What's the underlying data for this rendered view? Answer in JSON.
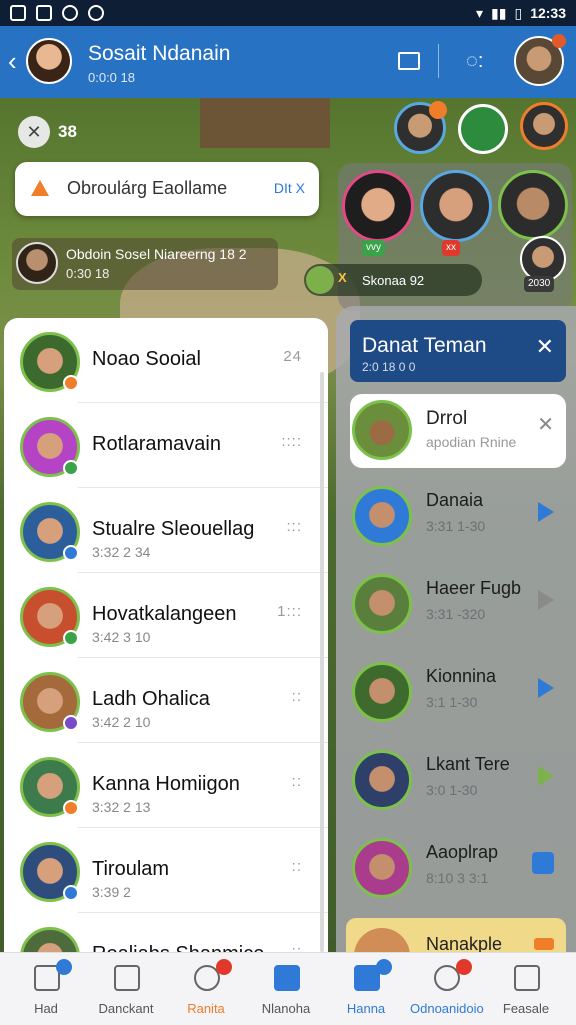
{
  "status_bar": {
    "time": "12:33"
  },
  "header": {
    "title": "Sosait Ndanain",
    "subtitle": "0:0:0 18"
  },
  "colors": {
    "header": "#2872c4",
    "accent": "#f07d2a",
    "status_online": "#7ec04c",
    "dark_blue": "#1e4a85"
  },
  "hud": {
    "counter": "38"
  },
  "notification": {
    "text": "Obroulárg Eaollame",
    "action": "DIt X"
  },
  "notice": {
    "line1": "Obdoin Sosel Niareerng 18 2",
    "line2": "0:30 18"
  },
  "status_pill": {
    "label": "Skonaa 92",
    "arrow": "X"
  },
  "cluster_chips": [
    "vvy",
    "xx"
  ],
  "cluster_time": "2030",
  "friends": [
    {
      "name": "Noao Sooial",
      "sub": "",
      "meta": "24",
      "color": "#3c6a2e"
    },
    {
      "name": "Rotlaramavain",
      "sub": "",
      "meta": "::::",
      "color": "#b543c6"
    },
    {
      "name": "Stualre Sleouellag",
      "sub": "3:32 2 34",
      "meta": ":::",
      "color": "#2d5e9c"
    },
    {
      "name": "Hovatkalangeen",
      "sub": "3:42 3 10",
      "meta": "1:::",
      "color": "#c84f2e"
    },
    {
      "name": "Ladh Ohalica",
      "sub": "3:42 2 10",
      "meta": "::",
      "color": "#a46a3c"
    },
    {
      "name": "Kanna Homiigon",
      "sub": "3:32 2 13",
      "meta": "::",
      "color": "#3d7a4c"
    },
    {
      "name": "Tiroulam",
      "sub": "3:39 2",
      "meta": "::",
      "color": "#2f4d7c"
    },
    {
      "name": "Roaliabs Shanmice",
      "sub": "",
      "meta": "::",
      "color": "#4e6b3c"
    }
  ],
  "panel": {
    "title": "Danat Teman",
    "subtitle": "2:0 18 0 0"
  },
  "request": {
    "name": "Drrol",
    "sub": "apodian Rnine"
  },
  "requests": [
    {
      "name": "Danaia",
      "sub": "3:31 1-30",
      "color": "#2f7ad6"
    },
    {
      "name": "Haeer Fugb",
      "sub": "3:31 -320",
      "color": "#5a7f3c"
    },
    {
      "name": "Kionnina",
      "sub": "3:1 1-30",
      "color": "#3f6a2e"
    },
    {
      "name": "Lkant Tere",
      "sub": "3:0 1-30",
      "color": "#2e3f6a"
    },
    {
      "name": "Aaoplrap",
      "sub": "8:10 3 3:1",
      "color": "#a93c8c"
    }
  ],
  "bottom_card": {
    "name": "Nanakple"
  },
  "nav": [
    {
      "label": "Had",
      "icon": "home-icon"
    },
    {
      "label": "Danckant",
      "icon": "friends-icon"
    },
    {
      "label": "Ranita",
      "icon": "target-icon"
    },
    {
      "label": "Nlanoha",
      "icon": "edit-icon"
    },
    {
      "label": "Hanna",
      "icon": "send-icon"
    },
    {
      "label": "Odnoanidoio",
      "icon": "chat-icon"
    },
    {
      "label": "Feasale",
      "icon": "thumb-icon"
    }
  ]
}
